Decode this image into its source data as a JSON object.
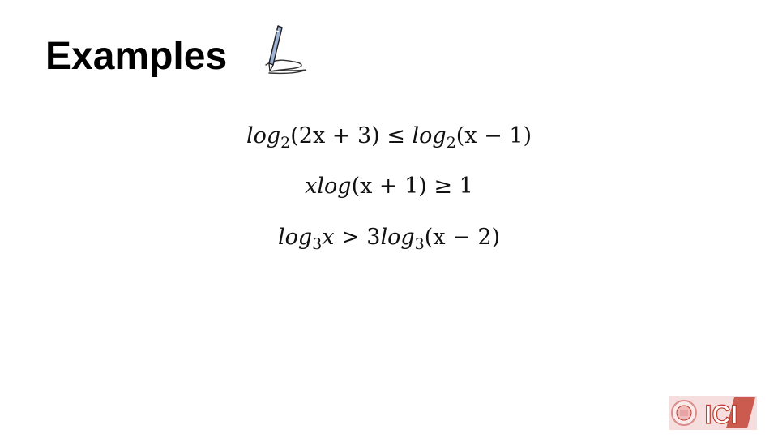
{
  "slide": {
    "title": "Examples"
  },
  "icons": {
    "title_icon": "pen-writing-icon",
    "logo": "ici-logo"
  },
  "equations": [
    {
      "left": {
        "fn": "log",
        "base": "2",
        "arg": "(2x + 3)"
      },
      "op": "≤",
      "right": {
        "fn": "log",
        "base": "2",
        "arg": "(x − 1)"
      }
    },
    {
      "lhs": "xlog",
      "arg": "(x + 1)",
      "op": "≥",
      "rhs": "1"
    },
    {
      "left": {
        "fn": "log",
        "base": "3",
        "arg": "x"
      },
      "op": ">",
      "right": {
        "coef": "3",
        "fn": "log",
        "base": "3",
        "arg": "(x − 2)"
      }
    }
  ],
  "logo": {
    "text": "ICI",
    "colors": {
      "primary": "#c0392b",
      "secondary": "#e8a6a6"
    }
  }
}
